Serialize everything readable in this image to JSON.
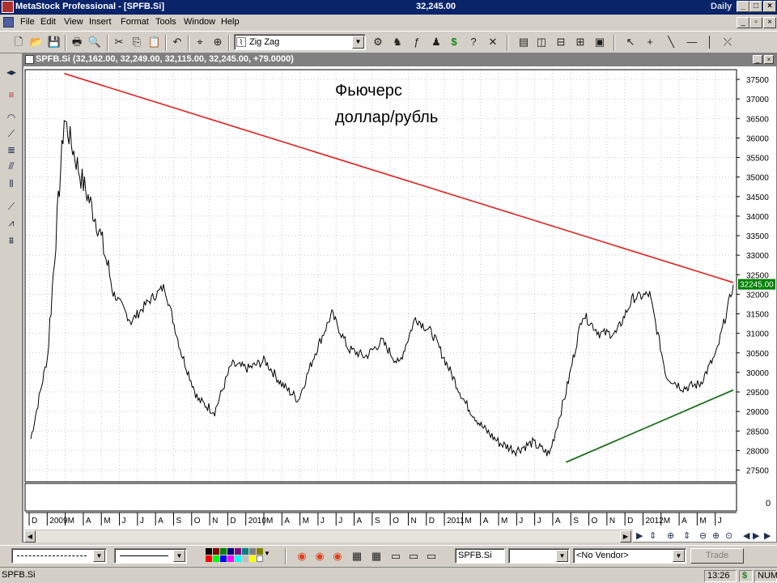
{
  "window": {
    "title": "MetaStock Professional - [SPFB.Si]",
    "center_price": "32,245.00",
    "periodicity": "Daily"
  },
  "menu": [
    "File",
    "Edit",
    "View",
    "Insert",
    "Format",
    "Tools",
    "Window",
    "Help"
  ],
  "toolbar": {
    "indicator_value": "Zig Zag"
  },
  "chart_window": {
    "title": "SPFB.Si (32,162.00, 32,249.00, 32,115.00, 32,245.00, +79.0000)",
    "annotation_line1": "Фьючерс",
    "annotation_line2": "доллар/рубль",
    "last_price_label": "32245.00",
    "lower_pane_value": "0"
  },
  "chart_data": {
    "type": "line",
    "title": "Фьючерс доллар/рубль",
    "series": [
      {
        "name": "SPFB.Si",
        "approx_close_by_month": [
          [
            "D '08",
            28300
          ],
          [
            "2009 Jan",
            30400
          ],
          [
            "2009 Feb",
            36500
          ],
          [
            "2009 Mar",
            35000
          ],
          [
            "2009 Apr",
            33800
          ],
          [
            "2009 May",
            32000
          ],
          [
            "2009 Jun",
            31300
          ],
          [
            "2009 Jul",
            31800
          ],
          [
            "2009 Aug",
            32200
          ],
          [
            "2009 Sep",
            30500
          ],
          [
            "2009 Oct",
            29300
          ],
          [
            "2009 Nov",
            29000
          ],
          [
            "2009 Dec",
            30200
          ],
          [
            "2010 Jan",
            30100
          ],
          [
            "2010 Feb",
            30300
          ],
          [
            "2010 Mar",
            29700
          ],
          [
            "2010 Apr",
            29300
          ],
          [
            "2010 May",
            30500
          ],
          [
            "2010 Jun",
            31500
          ],
          [
            "2010 Jul",
            30600
          ],
          [
            "2010 Aug",
            30400
          ],
          [
            "2010 Sep",
            30800
          ],
          [
            "2010 Oct",
            30200
          ],
          [
            "2010 Nov",
            31400
          ],
          [
            "2010 Dec",
            31000
          ],
          [
            "2011 Jan",
            30100
          ],
          [
            "2011 Feb",
            29200
          ],
          [
            "2011 Mar",
            28600
          ],
          [
            "2011 Apr",
            28200
          ],
          [
            "2011 May",
            28000
          ],
          [
            "2011 Jun",
            28200
          ],
          [
            "2011 Jul",
            27900
          ],
          [
            "2011 Aug",
            29500
          ],
          [
            "2011 Sep",
            31500
          ],
          [
            "2011 Oct",
            31000
          ],
          [
            "2011 Nov",
            31000
          ],
          [
            "2011 Dec",
            31900
          ],
          [
            "2012 Jan",
            32000
          ],
          [
            "2012 Feb",
            29900
          ],
          [
            "2012 Mar",
            29600
          ],
          [
            "2012 Apr",
            29700
          ],
          [
            "2012 May",
            30500
          ],
          [
            "2012 Jun",
            32245
          ]
        ]
      }
    ],
    "trendlines": [
      {
        "name": "resistance",
        "color": "#e02020",
        "from": [
          "2009 Feb",
          37650
        ],
        "to": [
          "2012 Jun",
          32300
        ]
      },
      {
        "name": "support",
        "color": "#207020",
        "from": [
          "2011 Aug",
          27700
        ],
        "to": [
          "2012 Jun",
          29550
        ]
      }
    ],
    "y_ticks": [
      27500,
      28000,
      28500,
      29000,
      29500,
      30000,
      30500,
      31000,
      31500,
      32000,
      32500,
      33000,
      33500,
      34000,
      34500,
      35000,
      35500,
      36000,
      36500,
      37000,
      37500
    ],
    "ylim": [
      27200,
      37750
    ],
    "x_tick_labels": [
      "D",
      "2009",
      "M",
      "A",
      "M",
      "J",
      "J",
      "A",
      "S",
      "O",
      "N",
      "D",
      "2010",
      "M",
      "A",
      "M",
      "J",
      "J",
      "A",
      "S",
      "O",
      "N",
      "D",
      "2011",
      "M",
      "A",
      "M",
      "J",
      "J",
      "A",
      "S",
      "O",
      "N",
      "D",
      "2012",
      "M",
      "A",
      "M",
      "J"
    ],
    "grid": true
  },
  "lower_toolbar": {
    "symbol_field": "SPFB.Si",
    "vendor_select": "<No Vendor>",
    "trade_button": "Trade"
  },
  "statusbar": {
    "left": "SPFB.Si",
    "time": "13:26",
    "right": "NUM"
  },
  "colors": {
    "titlebar": "#0a246a",
    "chart_bg": "#ffffff",
    "resistance_line": "#e02020",
    "support_line": "#207020",
    "last_price_bg": "#008000"
  }
}
